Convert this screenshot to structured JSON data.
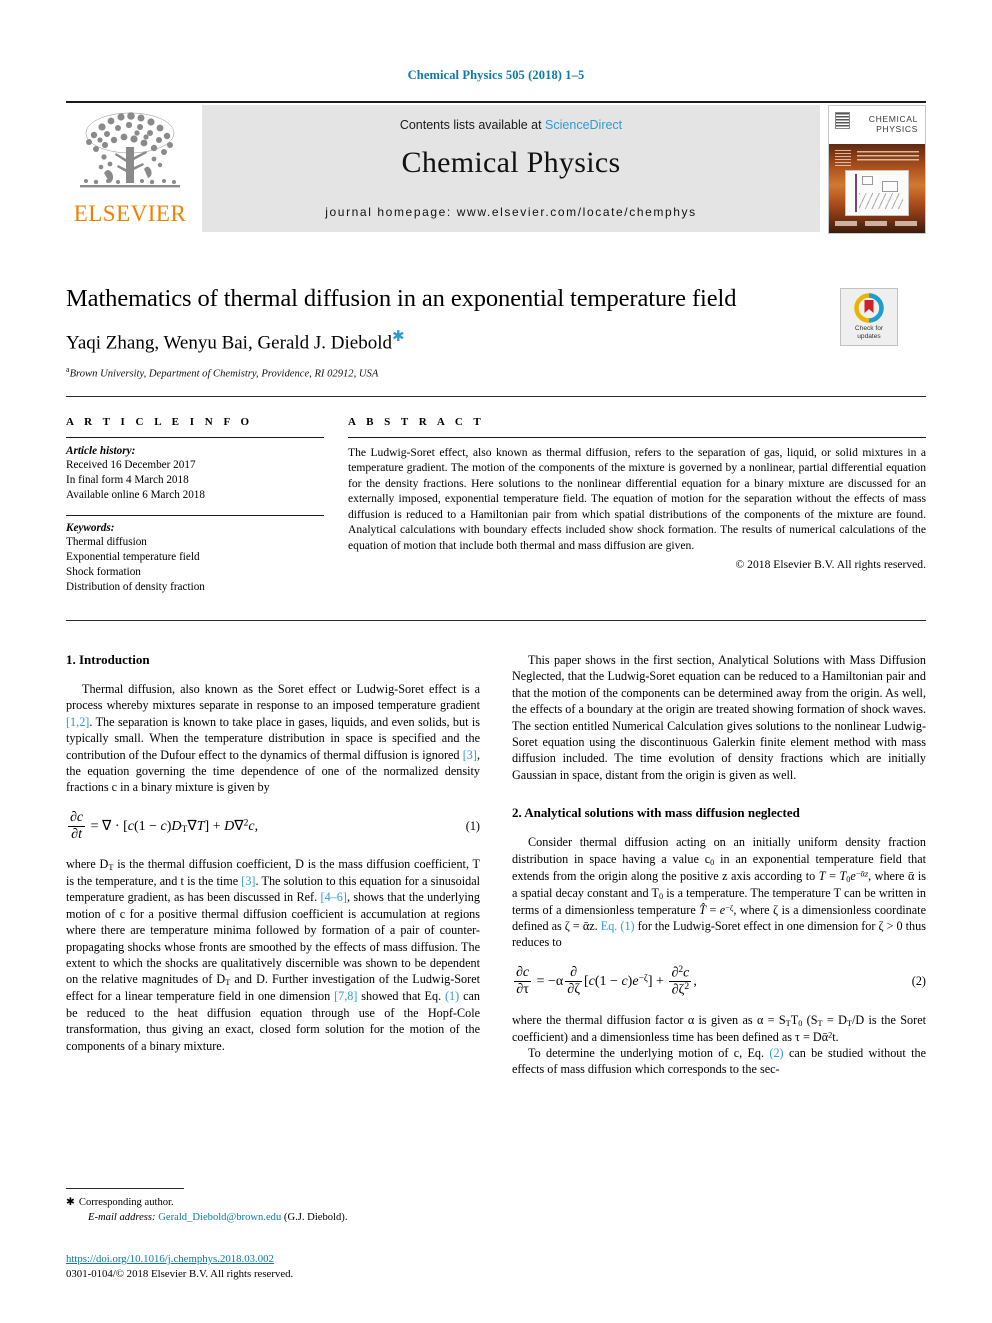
{
  "running_head": "Chemical Physics 505 (2018) 1–5",
  "masthead": {
    "publisher": "ELSEVIER",
    "contents_prefix": "Contents lists available at ",
    "contents_link": "ScienceDirect",
    "journal_title": "Chemical Physics",
    "homepage": "journal homepage: www.elsevier.com/locate/chemphys",
    "cover_journal_line1": "CHEMICAL",
    "cover_journal_line2": "PHYSICS"
  },
  "title_block": {
    "title": "Mathematics of thermal diffusion in an exponential temperature field",
    "authors": "Yaqi Zhang, Wenyu Bai, Gerald J. Diebold",
    "corresponding_mark": "✱",
    "affiliation_sup": "a",
    "affiliation": "Brown University, Department of Chemistry, Providence, RI 02912, USA",
    "check_updates_line1": "Check for",
    "check_updates_line2": "updates"
  },
  "article_info": {
    "heading": "A R T I C L E   I N F O",
    "history_heading": "Article history:",
    "history": [
      "Received 16 December 2017",
      "In final form 4 March 2018",
      "Available online 6 March 2018"
    ],
    "keywords_heading": "Keywords:",
    "keywords": [
      "Thermal diffusion",
      "Exponential temperature field",
      "Shock formation",
      "Distribution of density fraction"
    ]
  },
  "abstract": {
    "heading": "A B S T R A C T",
    "text": "The Ludwig-Soret effect, also known as thermal diffusion, refers to the separation of gas, liquid, or solid mixtures in a temperature gradient. The motion of the components of the mixture is governed by a nonlinear, partial differential equation for the density fractions. Here solutions to the nonlinear differential equation for a binary mixture are discussed for an externally imposed, exponential temperature field. The equation of motion for the separation without the effects of mass diffusion is reduced to a Hamiltonian pair from which spatial distributions of the components of the mixture are found. Analytical calculations with boundary effects included show shock formation. The results of numerical calculations of the equation of motion that include both thermal and mass diffusion are given.",
    "copyright": "© 2018 Elsevier B.V. All rights reserved."
  },
  "body": {
    "section1_heading": "1. Introduction",
    "section1_p1_a": "Thermal diffusion, also known as the Soret effect or Ludwig-Soret effect is a process whereby mixtures separate in response to an imposed temperature gradient ",
    "section1_p1_ref1": "[1,2]",
    "section1_p1_b": ". The separation is known to take place in gases, liquids, and even solids, but is typically small. When the temperature distribution in space is specified and the contribution of the Dufour effect to the dynamics of thermal diffusion is ignored ",
    "section1_p1_ref2": "[3]",
    "section1_p1_c": ", the equation governing the time dependence of one of the normalized density fractions c in a binary mixture is given by",
    "eq1_number": "(1)",
    "section1_p2_a": "where D",
    "section1_p2_b": " is the thermal diffusion coefficient, D is the mass diffusion coefficient, T is the temperature, and t is the time ",
    "section1_p2_ref1": "[3]",
    "section1_p2_c": ". The solution to this equation for a sinusoidal temperature gradient, as has been discussed in Ref. ",
    "section1_p2_ref2": "[4–6]",
    "section1_p2_d": ", shows that the underlying motion of c for a positive thermal diffusion coefficient is accumulation at regions where there are temperature minima followed by formation of a pair of counter-propagating shocks whose fronts are smoothed by the effects of mass diffusion. The extent to which the shocks are qualitatively discernible was shown to be dependent on the relative magnitudes of D",
    "section1_p2_e": " and D. Further investigation of the Ludwig-Soret effect for a linear temperature field in one dimension ",
    "section1_p2_ref3": "[7,8]",
    "section1_p2_f": " showed that Eq. ",
    "section1_p2_ref4": "(1)",
    "section1_p2_g": " can be reduced to the heat diffusion equation through use of the Hopf-Cole transformation, thus giving an exact, closed form solution for the motion of the components of a binary mixture.",
    "right_p1": "This paper shows in the first section, Analytical Solutions with Mass Diffusion Neglected, that the Ludwig-Soret equation can be reduced to a Hamiltonian pair and that the motion of the components can be determined away from the origin. As well, the effects of a boundary at the origin are treated showing formation of shock waves. The section entitled Numerical Calculation gives solutions to the nonlinear Ludwig-Soret equation using the discontinuous Galerkin finite element method with mass diffusion included. The time evolution of density fractions which are initially Gaussian in space, distant from the origin is given as well.",
    "section2_heading": "2. Analytical solutions with mass diffusion neglected",
    "section2_p1_a": "Consider thermal diffusion acting on an initially uniform density fraction distribution in space having a value c",
    "section2_p1_b": " in an exponential temperature field that extends from the origin along the positive z axis according to ",
    "section2_p1_c": ", where ᾱ is a spatial decay constant and T",
    "section2_p1_d": " is a temperature. The temperature T can be written in terms of a dimensionless temperature ",
    "section2_p1_e": ", where ζ is a dimensionless coordinate defined as ζ = ᾱz. ",
    "section2_p1_ref": "Eq. (1)",
    "section2_p1_f": " for the Ludwig-Soret effect in one dimension for ζ > 0 thus reduces to",
    "eq2_number": "(2)",
    "section2_p2_a": "where the thermal diffusion factor α is given as α = S",
    "section2_p2_b": "T",
    "section2_p2_c": " (S",
    "section2_p2_d": " = D",
    "section2_p2_e": "/D is the Soret coefficient) and a dimensionless time has been defined as τ = Dᾱ",
    "section2_p2_f": "t.",
    "section2_p3_a": "To determine the underlying motion of c, Eq. ",
    "section2_p3_ref": "(2)",
    "section2_p3_b": " can be studied without the effects of mass diffusion which corresponds to the sec-"
  },
  "footnote": {
    "star": "✱",
    "corresponding": "Corresponding author.",
    "email_label": "E-mail address:",
    "email": "Gerald_Diebold@brown.edu",
    "email_owner": "(G.J. Diebold)."
  },
  "doi_block": {
    "doi": "https://doi.org/10.1016/j.chemphys.2018.03.002",
    "issn_line": "0301-0104/© 2018 Elsevier B.V. All rights reserved."
  },
  "colors": {
    "link_blue": "#2e9bd6",
    "deep_blue": "#0b7aa8",
    "elsevier_orange": "#f08000",
    "band_gray": "#e4e4e4"
  }
}
